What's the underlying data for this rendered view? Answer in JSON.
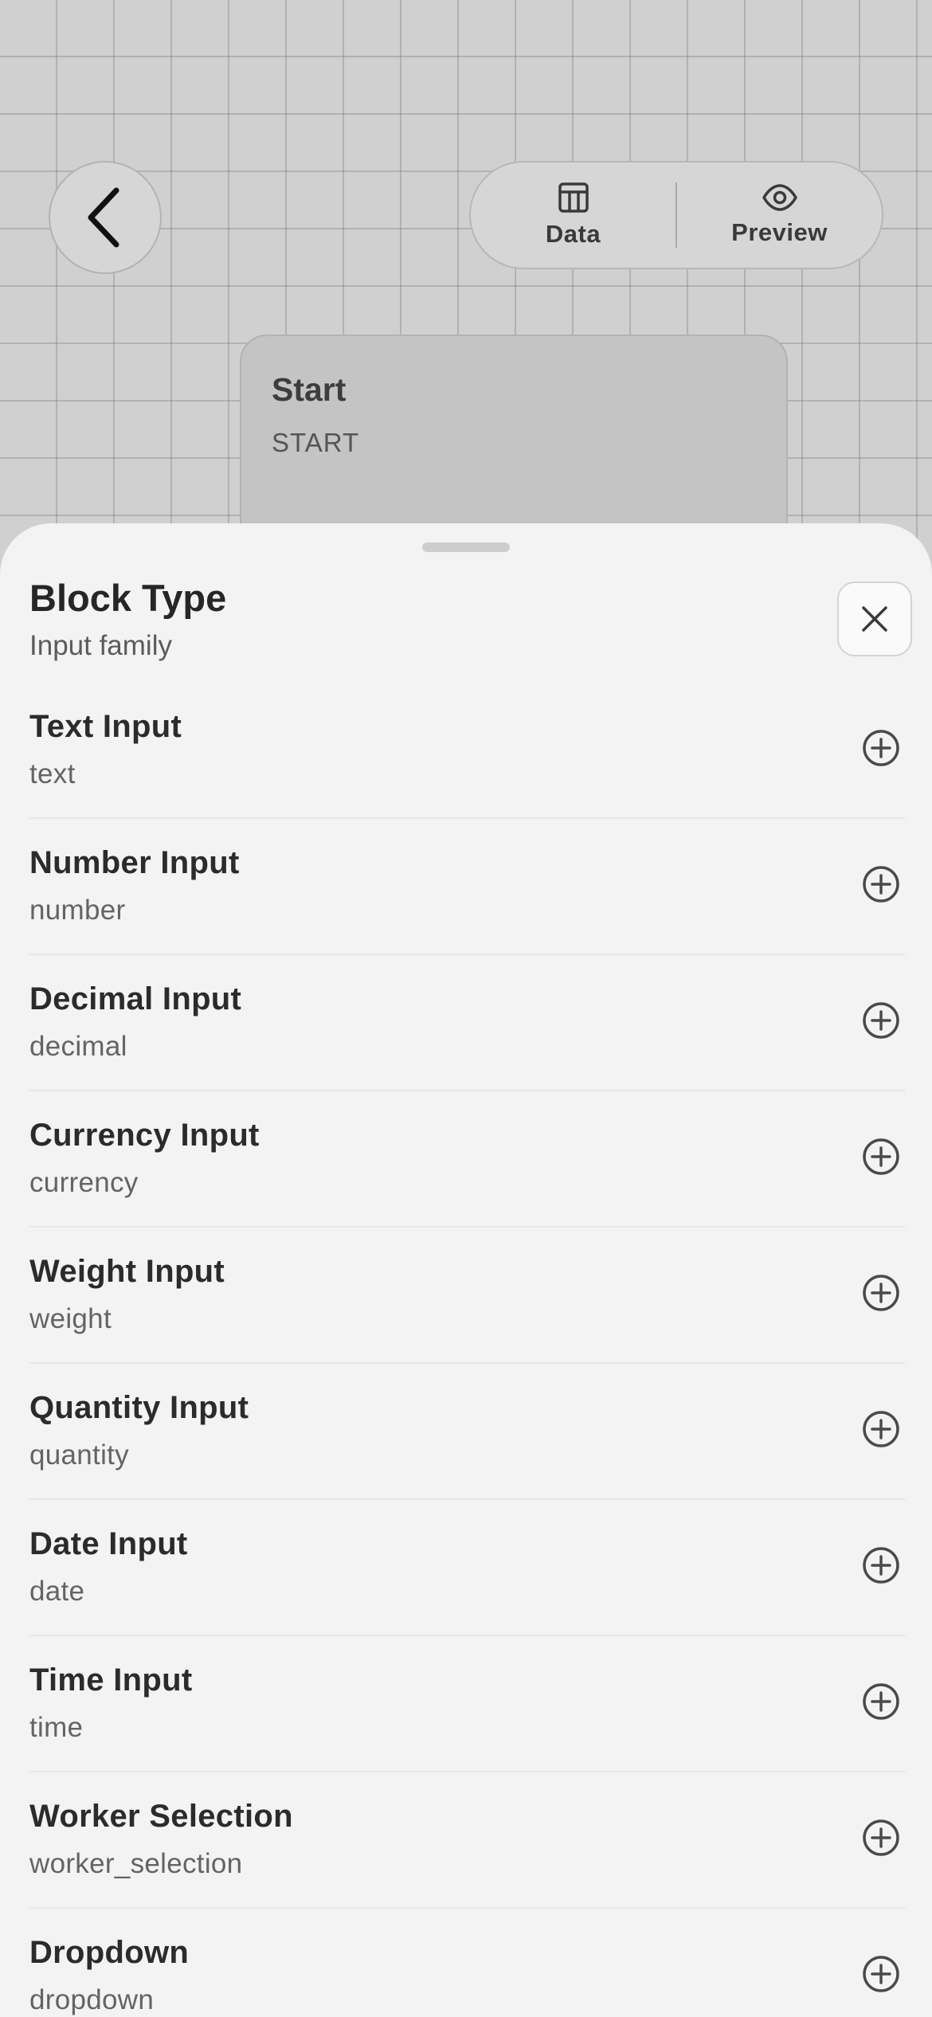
{
  "toolbar": {
    "back_icon": "chevron-left-icon",
    "data_label": "Data",
    "data_icon": "table-icon",
    "preview_label": "Preview",
    "preview_icon": "eye-icon"
  },
  "canvas": {
    "start_node": {
      "title": "Start",
      "subtitle": "START"
    }
  },
  "sheet": {
    "title": "Block Type",
    "subtitle": "Input family",
    "close_icon": "close-icon",
    "items": [
      {
        "label": "Text Input",
        "type": "text"
      },
      {
        "label": "Number Input",
        "type": "number"
      },
      {
        "label": "Decimal Input",
        "type": "decimal"
      },
      {
        "label": "Currency Input",
        "type": "currency"
      },
      {
        "label": "Weight Input",
        "type": "weight"
      },
      {
        "label": "Quantity Input",
        "type": "quantity"
      },
      {
        "label": "Date Input",
        "type": "date"
      },
      {
        "label": "Time Input",
        "type": "time"
      },
      {
        "label": "Worker Selection",
        "type": "worker_selection"
      },
      {
        "label": "Dropdown",
        "type": "dropdown"
      }
    ],
    "add_icon": "plus-circle-icon"
  },
  "colors": {
    "sheet_bg": "#f3f3f3",
    "canvas_bg": "#d0d0d0",
    "node_bg": "#c4c4c4"
  }
}
